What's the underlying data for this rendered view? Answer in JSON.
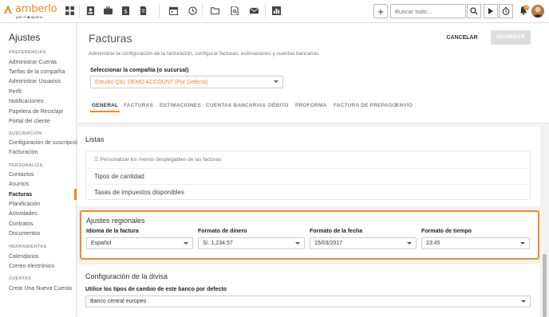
{
  "brand": {
    "name": "amberlo",
    "sub": "part of ◆ alpione",
    "accent": "#ef8a27"
  },
  "toolbar": {
    "icons": [
      "dashboard-icon",
      "contacts-icon",
      "briefcase-icon",
      "invoice-icon",
      "document-icon",
      "calendar-icon",
      "history-icon",
      "folder-icon",
      "folder-search-icon",
      "mail-icon",
      "reports-icon"
    ],
    "add_label": "+",
    "search_placeholder": "Buscar todo...",
    "notifications_count": "3"
  },
  "sidebar": {
    "title": "Ajustes",
    "sections": [
      {
        "label": "PREFERENCIAS",
        "items": [
          "Administrar Cuenta",
          "Tarifas de la compañía",
          "Administrar Usuarios",
          "Perfil",
          "Notificaciones",
          "Papelera de Reciclaje",
          "Portal del cliente"
        ]
      },
      {
        "label": "SUSCRIPCIÓN",
        "items": [
          "Configuración de suscripción",
          "Facturación"
        ]
      },
      {
        "label": "PERSONALIZA",
        "items": [
          "Contactos",
          "Asuntos",
          "Facturas",
          "Planificación",
          "Actividades",
          "Contratos",
          "Documentos"
        ]
      },
      {
        "label": "HERRAMIENTAS",
        "items": [
          "Calendarios",
          "Correo electrónico"
        ]
      },
      {
        "label": "CUENTAS",
        "items": [
          "Crear Una Nueva Cuenta"
        ]
      }
    ],
    "active": "Facturas"
  },
  "header": {
    "title": "Facturas",
    "subtitle": "Administrar la configuración de la facturación, configurar facturas, estimaciones y cuentas bancarias",
    "cancel_label": "CANCELAR",
    "save_label": "GUARDAR",
    "company_label": "Seleccionar la compañía (o sucursal)",
    "company_value": "Estudio Q&L DEMO ACCOUNT (Por Defecto)"
  },
  "tabs": [
    "GENERAL",
    "FACTURAS",
    "ESTIMACIONES",
    "CUENTAS BANCARIAS",
    "DÉBITO",
    "PROFORMA",
    "FACTURA DE PREPAGO",
    "ENVÍO"
  ],
  "listas": {
    "title": "Listas",
    "customize_link": "Personalizar los menús desplegables de las facturas",
    "rows": [
      "Tipos de cantidad",
      "Tasas de impuestos disponibles"
    ]
  },
  "regional": {
    "title": "Ajustes regionales",
    "fields": [
      {
        "label": "Idioma de la factura",
        "value": "Español"
      },
      {
        "label": "Formato de dinero",
        "value": "S/. 1,234.57"
      },
      {
        "label": "Formato de la fecha",
        "value": "15/03/2017"
      },
      {
        "label": "Formato de tiempo",
        "value": "23:45"
      }
    ]
  },
  "divisa": {
    "title": "Configuración de la divisa",
    "label": "Utilice los tipos de cambio de este banco por defecto",
    "value": "Banco central europeo"
  }
}
